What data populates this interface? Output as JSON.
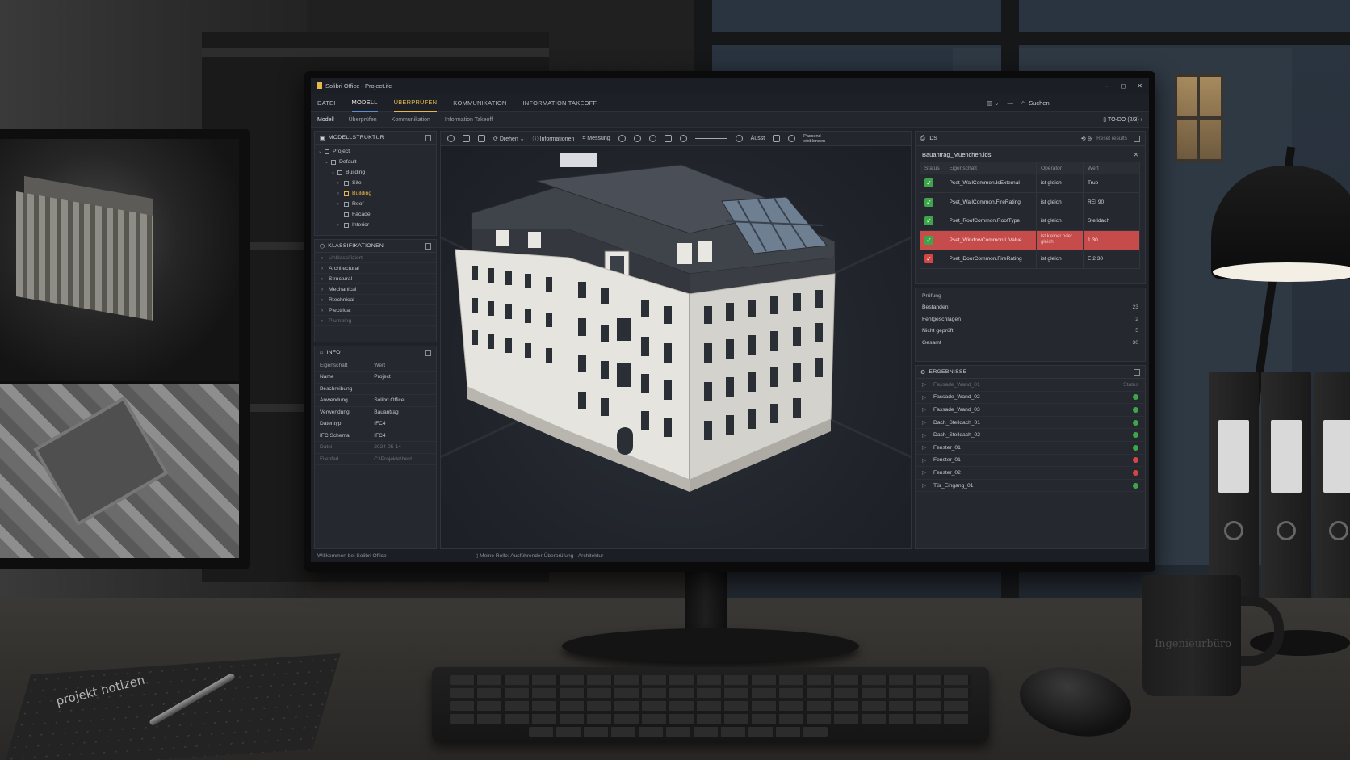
{
  "app": {
    "title": "Solibri Office - Project.ifc",
    "window_controls": [
      "–",
      "◻",
      "✕"
    ]
  },
  "menu": {
    "items": [
      {
        "label": "DATEI",
        "state": "normal"
      },
      {
        "label": "MODELL",
        "state": "active"
      },
      {
        "label": "ÜBERPRÜFEN",
        "state": "highlight"
      },
      {
        "label": "KOMMUNIKATION",
        "state": "normal"
      },
      {
        "label": "INFORMATION TAKEOFF",
        "state": "normal"
      }
    ],
    "search_placeholder": "Suchen"
  },
  "subtabs": {
    "items": [
      "Modell",
      "Überprüfen",
      "Kommunikation",
      "Information Takeoff"
    ],
    "todo": "TO-DO (2/3)"
  },
  "model_tree": {
    "header": "MODELLSTRUKTUR",
    "items": [
      {
        "label": "Project",
        "level": 0,
        "expanded": true
      },
      {
        "label": "Default",
        "level": 1,
        "expanded": true
      },
      {
        "label": "Building",
        "level": 2,
        "expanded": true
      },
      {
        "label": "Site",
        "level": 3,
        "expanded": false
      },
      {
        "label": "Building",
        "level": 3,
        "expanded": false,
        "selected": true
      },
      {
        "label": "Roof",
        "level": 3,
        "expanded": false
      },
      {
        "label": "Facade",
        "level": 3,
        "expanded": false
      },
      {
        "label": "Interior",
        "level": 3,
        "expanded": false
      }
    ]
  },
  "classifications": {
    "header": "KLASSIFIKATIONEN",
    "items": [
      {
        "label": "Unklassifiziert",
        "dim": true
      },
      {
        "label": "Architectural",
        "dim": false
      },
      {
        "label": "Structural",
        "dim": false
      },
      {
        "label": "Mechanical",
        "dim": false
      },
      {
        "label": "Rtechnical",
        "dim": false
      },
      {
        "label": "Plectrical",
        "dim": false
      },
      {
        "label": "Plumbing",
        "dim": true
      }
    ]
  },
  "info": {
    "header": "INFO",
    "columns": [
      "Eigenschaft",
      "Wert"
    ],
    "rows": [
      {
        "k": "Name",
        "v": "Project",
        "dim": false
      },
      {
        "k": "Beschreibung",
        "v": "",
        "dim": false
      },
      {
        "k": "Anwendung",
        "v": "Solibri Office",
        "dim": false
      },
      {
        "k": "Verwendung",
        "v": "Bauantrag",
        "dim": false
      },
      {
        "k": "Datentyp",
        "v": "IFC4",
        "dim": false
      },
      {
        "k": "IFC Schema",
        "v": "IFC4",
        "dim": false
      },
      {
        "k": "Datei",
        "v": "2024-05-14",
        "dim": true
      },
      {
        "k": "Filepfad",
        "v": "C:\\Projekte\\best...",
        "dim": true
      }
    ]
  },
  "viewport_toolbar": {
    "rotate": "Drehen",
    "information": "Informationen",
    "measure": "Messung",
    "reset": "Äusst",
    "fit": "Passend einblenden"
  },
  "ids": {
    "header": "IDS",
    "reset_label": "Reset results",
    "file": "Bauantrag_Muenchen.ids",
    "columns": [
      "Status",
      "Eigenschaft",
      "Operator",
      "Wert"
    ],
    "rows": [
      {
        "status": "ok",
        "property": "Pset_WallCommon.IsExternal",
        "operator": "ist gleich",
        "value": "True",
        "failed": false
      },
      {
        "status": "ok",
        "property": "Pset_WallCommon.FireRating",
        "operator": "ist gleich",
        "value": "REI 90",
        "failed": false
      },
      {
        "status": "ok",
        "property": "Pset_RoofCommon.RoofType",
        "operator": "ist gleich",
        "value": "Steildach",
        "failed": false
      },
      {
        "status": "ok",
        "property": "Pset_WindowCommon.UValue",
        "operator": "ist kleiner oder gleich",
        "value": "1.30",
        "failed": true
      },
      {
        "status": "bad",
        "property": "Pset_DoorCommon.FireRating",
        "operator": "ist gleich",
        "value": "EI2 30",
        "failed": false
      }
    ]
  },
  "check": {
    "title": "Prüfung",
    "rows": [
      {
        "label": "Bestanden",
        "value": "23"
      },
      {
        "label": "Fehlgeschlagen",
        "value": "2"
      },
      {
        "label": "Nicht geprüft",
        "value": "5"
      },
      {
        "label": "Gesamt",
        "value": "30"
      }
    ]
  },
  "results": {
    "header": "ERGEBNISSE",
    "first_row": "Fassade_Wand_01",
    "sort_label": "Status",
    "items": [
      {
        "label": "Fassade_Wand_02",
        "status": "ok"
      },
      {
        "label": "Fassade_Wand_03",
        "status": "ok"
      },
      {
        "label": "Dach_Steildach_01",
        "status": "ok"
      },
      {
        "label": "Dach_Steildach_02",
        "status": "ok"
      },
      {
        "label": "Fenster_01",
        "status": "ok"
      },
      {
        "label": "Fenster_01",
        "status": "bad"
      },
      {
        "label": "Fenster_02",
        "status": "bad"
      },
      {
        "label": "Tür_Eingang_01",
        "status": "ok"
      }
    ]
  },
  "statusbar": {
    "welcome": "Willkommen bei Solibri Office",
    "role": "Meine Rolle: Ausführender Überprüfung - Architektur"
  },
  "scene": {
    "notebook_text": "projekt notizen",
    "mug_text": "Ingenieurbüro"
  },
  "colors": {
    "accent_blue": "#5a8fd8",
    "accent_yellow": "#e6b84a",
    "pass_green": "#3fa54a",
    "fail_red": "#d64545",
    "fail_row": "#c64b4b"
  }
}
